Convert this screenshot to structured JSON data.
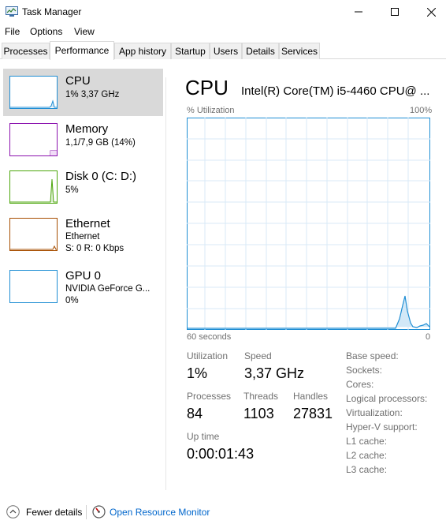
{
  "window": {
    "title": "Task Manager",
    "icon": "task-manager-icon"
  },
  "menu": [
    "File",
    "Options",
    "View"
  ],
  "tabs": [
    "Processes",
    "Performance",
    "App history",
    "Startup",
    "Users",
    "Details",
    "Services"
  ],
  "active_tab": "Performance",
  "sidebar": {
    "items": [
      {
        "title": "CPU",
        "line1": "1% 3,37 GHz",
        "line2": "",
        "color": "#1f8ed4",
        "selected": true
      },
      {
        "title": "Memory",
        "line1": "1,1/7,9 GB (14%)",
        "line2": "",
        "color": "#8b12ae",
        "selected": false
      },
      {
        "title": "Disk 0 (C: D:)",
        "line1": "5%",
        "line2": "",
        "color": "#4da60c",
        "selected": false
      },
      {
        "title": "Ethernet",
        "line1": "Ethernet",
        "line2": "S: 0 R: 0 Kbps",
        "color": "#a74f01",
        "selected": false
      },
      {
        "title": "GPU 0",
        "line1": "NVIDIA GeForce G...",
        "line2": "0%",
        "color": "#1f8ed4",
        "selected": false
      }
    ]
  },
  "main": {
    "title": "CPU",
    "model": "Intel(R) Core(TM) i5-4460 CPU@ ...",
    "graph_top_left": "% Utilization",
    "graph_top_right": "100%",
    "graph_bottom_left": "60 seconds",
    "graph_bottom_right": "0",
    "graph_color": "#1f8ed4",
    "stats": {
      "utilization_label": "Utilization",
      "utilization_value": "1%",
      "speed_label": "Speed",
      "speed_value": "3,37 GHz",
      "processes_label": "Processes",
      "processes_value": "84",
      "threads_label": "Threads",
      "threads_value": "1103",
      "handles_label": "Handles",
      "handles_value": "27831",
      "uptime_label": "Up time",
      "uptime_value": "0:00:01:43"
    },
    "specs": [
      "Base speed:",
      "Sockets:",
      "Cores:",
      "Logical processors:",
      "Virtualization:",
      "Hyper-V support:",
      "L1 cache:",
      "L2 cache:",
      "L3 cache:"
    ]
  },
  "footer": {
    "fewer_details": "Fewer details",
    "open_monitor": "Open Resource Monitor"
  }
}
